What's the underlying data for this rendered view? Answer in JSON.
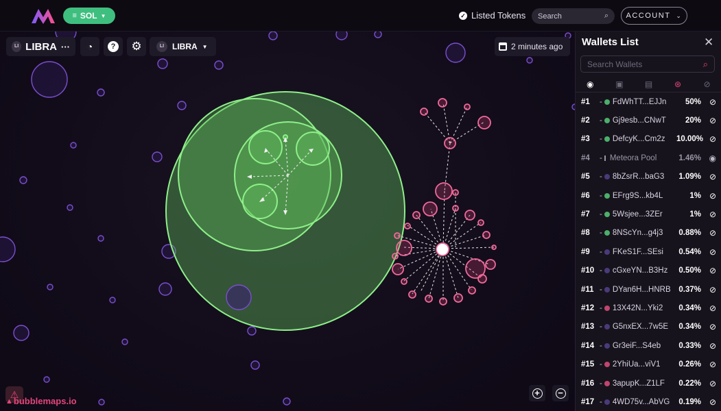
{
  "header": {
    "chain_label": "SOL",
    "listed_tokens_label": "Listed Tokens",
    "search_placeholder": "Search",
    "account_label": "ACCOUNT"
  },
  "toolbar": {
    "token_badge": "LI",
    "token_name": "LIBRA",
    "token_more": "···",
    "selector_badge": "LI",
    "selector_label": "LIBRA",
    "updated_label": "2 minutes ago"
  },
  "brand": "bubblemaps.io",
  "wallets_panel": {
    "title": "Wallets List",
    "search_placeholder": "Search Wallets",
    "wallets": [
      {
        "rank": "#1",
        "address": "FdWhTT...EJJn",
        "percent": "50%",
        "color": "#4caf6a",
        "hidden": true
      },
      {
        "rank": "#2",
        "address": "Gj9esb...CNwT",
        "percent": "20%",
        "color": "#4caf6a",
        "hidden": true
      },
      {
        "rank": "#3",
        "address": "DefcyK...Cm2z",
        "percent": "10.00%",
        "color": "#4caf6a",
        "hidden": true
      },
      {
        "rank": "#4",
        "address": "Meteora Pool",
        "percent": "1.46%",
        "color": "#9a95a4",
        "hidden": false,
        "dim": true
      },
      {
        "rank": "#5",
        "address": "8bZsrR...baG3",
        "percent": "1.09%",
        "color": "#4a3a7a",
        "hidden": true
      },
      {
        "rank": "#6",
        "address": "EFrg9S...kb4L",
        "percent": "1%",
        "color": "#4caf6a",
        "hidden": true
      },
      {
        "rank": "#7",
        "address": "5Wsjee...3ZEr",
        "percent": "1%",
        "color": "#4caf6a",
        "hidden": true
      },
      {
        "rank": "#8",
        "address": "8NScYn...g4j3",
        "percent": "0.88%",
        "color": "#4caf6a",
        "hidden": true
      },
      {
        "rank": "#9",
        "address": "FKeS1F...SEsi",
        "percent": "0.54%",
        "color": "#4a3a7a",
        "hidden": true
      },
      {
        "rank": "#10",
        "address": "cGxeYN...B3Hz",
        "percent": "0.50%",
        "color": "#4a3a7a",
        "hidden": true
      },
      {
        "rank": "#11",
        "address": "DYan6H...HNRB",
        "percent": "0.37%",
        "color": "#4a3a7a",
        "hidden": true
      },
      {
        "rank": "#12",
        "address": "13X42N...Yki2",
        "percent": "0.34%",
        "color": "#c0456e",
        "hidden": true
      },
      {
        "rank": "#13",
        "address": "G5nxEX...7w5E",
        "percent": "0.34%",
        "color": "#4a3a7a",
        "hidden": true
      },
      {
        "rank": "#14",
        "address": "Gr3eiF...S4eb",
        "percent": "0.33%",
        "color": "#4a3a7a",
        "hidden": true
      },
      {
        "rank": "#15",
        "address": "2YhiUa...viV1",
        "percent": "0.26%",
        "color": "#c0456e",
        "hidden": true
      },
      {
        "rank": "#16",
        "address": "3apupK...Z1LF",
        "percent": "0.22%",
        "color": "#c0456e",
        "hidden": true
      },
      {
        "rank": "#17",
        "address": "4WD75v...AbVG",
        "percent": "0.19%",
        "color": "#4a3a7a",
        "hidden": true
      }
    ]
  },
  "colors": {
    "accent_green": "#3fbf7f",
    "bubble_green": "#7ee07a",
    "bubble_pink": "#e5457a",
    "bubble_purple": "#7a4fd0"
  }
}
